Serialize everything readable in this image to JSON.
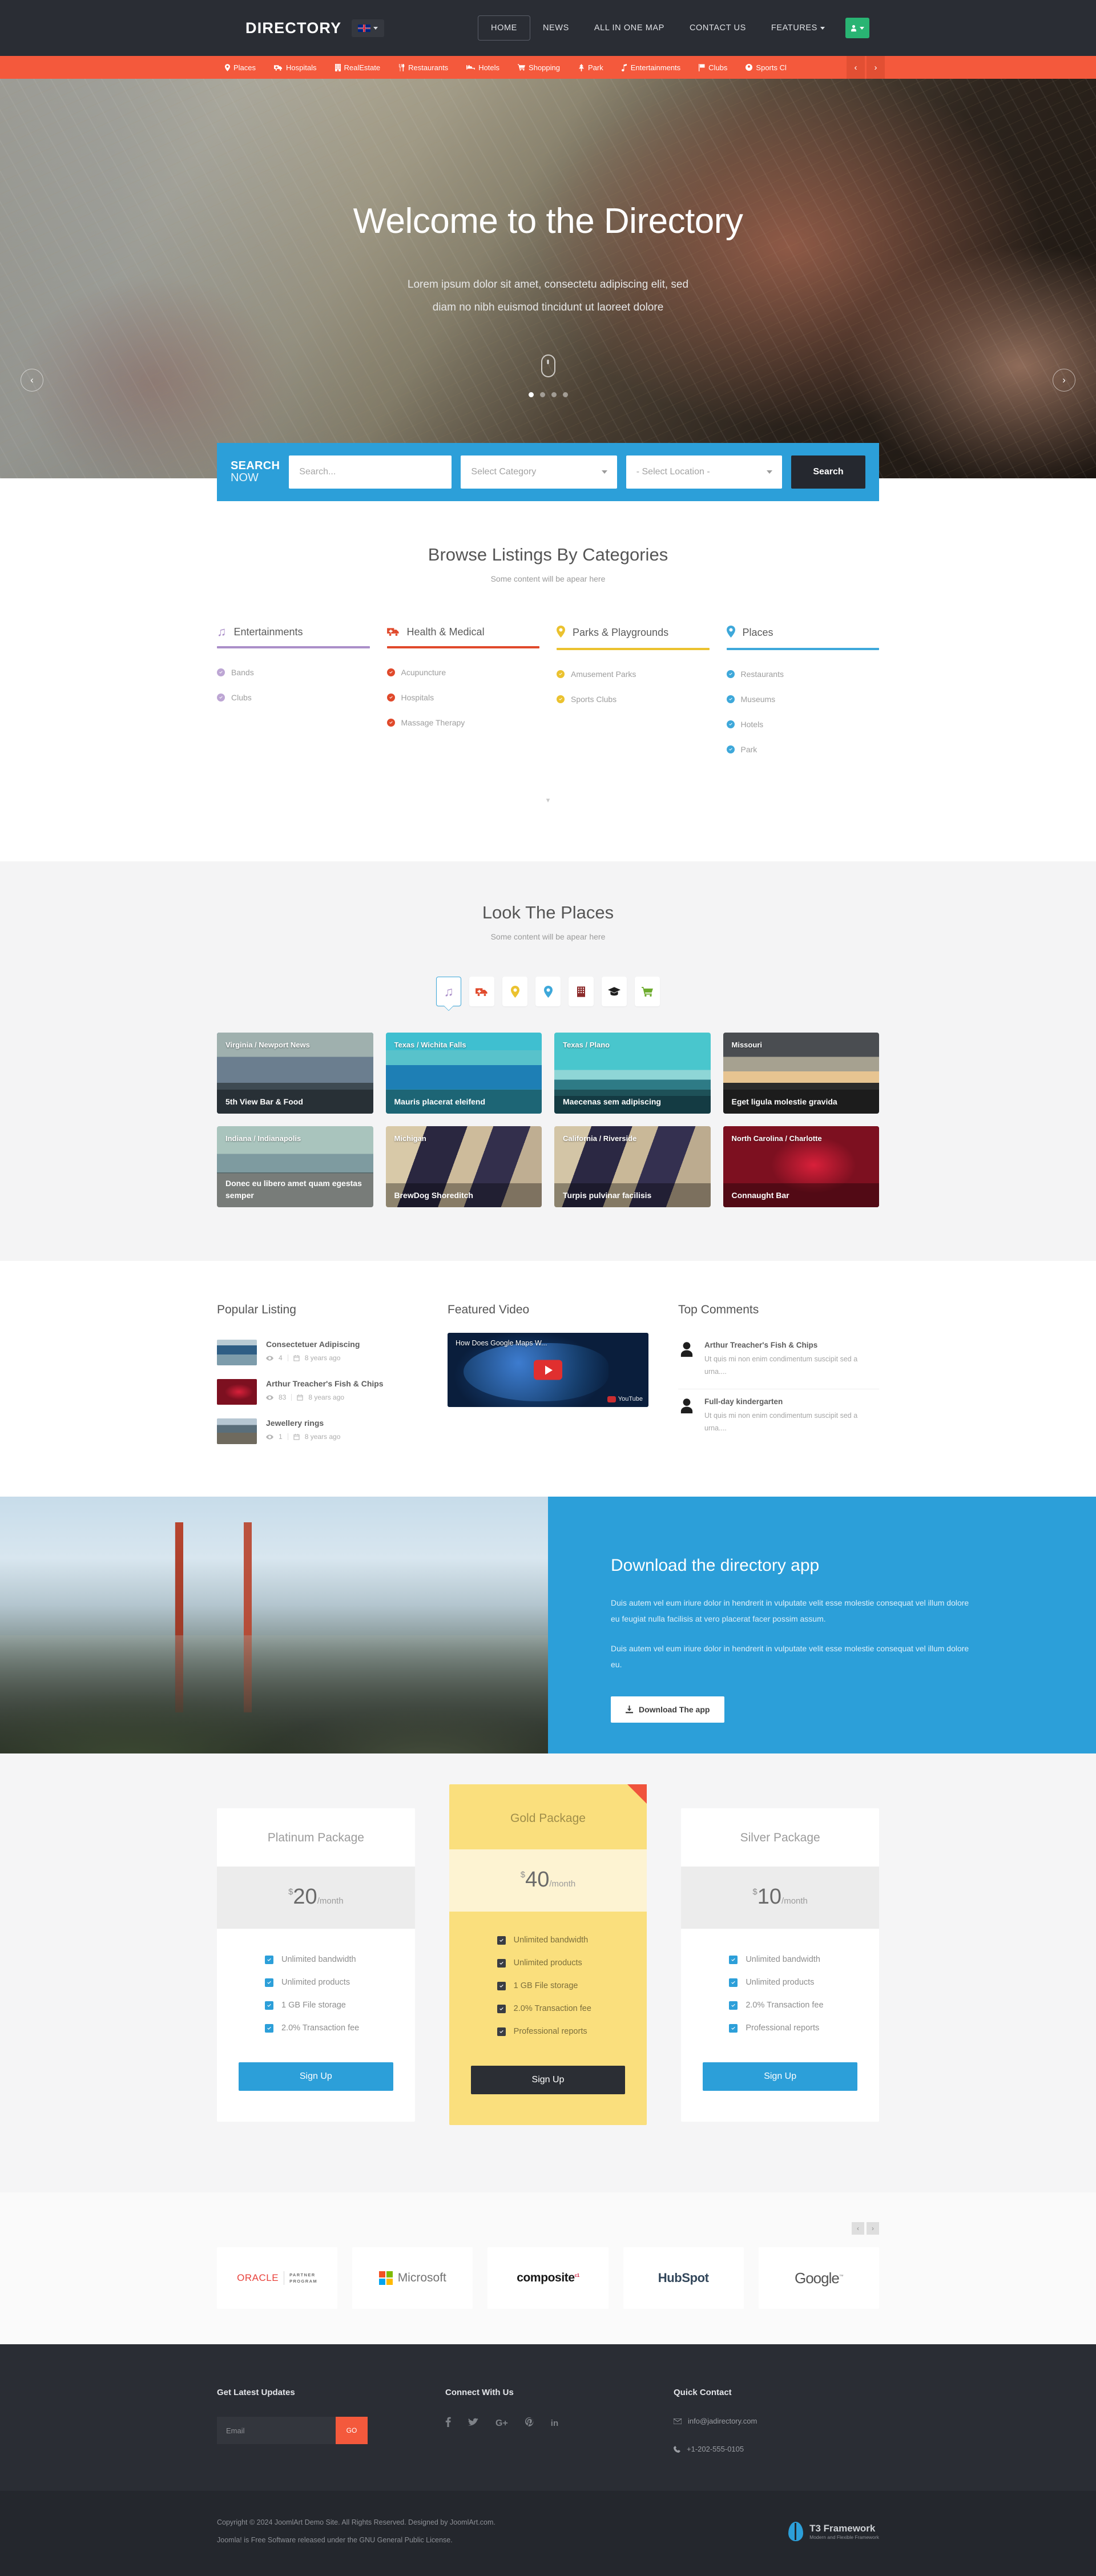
{
  "header": {
    "brand": "DIRECTORY",
    "lang_icon": "uk-flag-icon",
    "menu": [
      {
        "label": "HOME",
        "active": true,
        "caret": false
      },
      {
        "label": "NEWS",
        "active": false,
        "caret": false
      },
      {
        "label": "ALL IN ONE MAP",
        "active": false,
        "caret": false
      },
      {
        "label": "CONTACT US",
        "active": false,
        "caret": false
      },
      {
        "label": "FEATURES",
        "active": false,
        "caret": true
      }
    ],
    "user_icon": "user-icon",
    "user_accent": "#29b473"
  },
  "category_bar": {
    "accent": "#f4593c",
    "items": [
      {
        "label": "Places",
        "icon": "map-marker-icon"
      },
      {
        "label": "Hospitals",
        "icon": "ambulance-icon"
      },
      {
        "label": "RealEstate",
        "icon": "building-icon"
      },
      {
        "label": "Restaurants",
        "icon": "cutlery-icon"
      },
      {
        "label": "Hotels",
        "icon": "bed-icon"
      },
      {
        "label": "Shopping",
        "icon": "shopping-cart-icon"
      },
      {
        "label": "Park",
        "icon": "tree-icon"
      },
      {
        "label": "Entertainments",
        "icon": "music-icon"
      },
      {
        "label": "Clubs",
        "icon": "flag-icon"
      },
      {
        "label": "Sports Cl",
        "icon": "soccer-ball-icon"
      }
    ],
    "prev": "‹",
    "next": "›"
  },
  "hero": {
    "title": "Welcome to the Directory",
    "subtitle_line1": "Lorem ipsum dolor sit amet, consectetu adipiscing elit, sed",
    "subtitle_line2": "diam no nibh euismod tincidunt ut laoreet dolore",
    "prev": "‹",
    "next": "›",
    "dots": 4,
    "active_dot": 0,
    "scroll_icon": "mouse-scroll-icon"
  },
  "search": {
    "label_top": "SEARCH",
    "label_bottom": "NOW",
    "placeholder": "Search...",
    "category_value": "Select Category",
    "location_value": "- Select Location -",
    "button": "Search",
    "accent": "#2c9fd9"
  },
  "browse": {
    "title": "Browse Listings By Categories",
    "subtitle": "Some content will be apear here",
    "more_icon": "chevron-down-icon",
    "columns": [
      {
        "name": "Entertainments",
        "icon": "music-note-icon",
        "color": "#ab8fc9",
        "items": [
          "Bands",
          "Clubs"
        ]
      },
      {
        "name": "Health & Medical",
        "icon": "ambulance-icon",
        "color": "#e0492b",
        "items": [
          "Acupuncture",
          "Hospitals",
          "Massage Therapy"
        ]
      },
      {
        "name": "Parks & Playgrounds",
        "icon": "map-marker-icon",
        "color": "#ebc22f",
        "items": [
          "Amusement Parks",
          "Sports Clubs"
        ]
      },
      {
        "name": "Places",
        "icon": "map-marker-icon",
        "color": "#3ea8da",
        "items": [
          "Restaurants",
          "Museums",
          "Hotels",
          "Park"
        ]
      }
    ]
  },
  "look_places": {
    "title": "Look The Places",
    "subtitle": "Some content will be apear here",
    "tabs": [
      {
        "icon": "music-note-icon",
        "color": "#ab8fc9",
        "active": true
      },
      {
        "icon": "ambulance-icon",
        "color": "#e0492b",
        "active": false
      },
      {
        "icon": "map-marker-icon",
        "color": "#ebc22f",
        "active": false
      },
      {
        "icon": "map-marker-icon",
        "color": "#3ea8da",
        "active": false
      },
      {
        "icon": "building-icon",
        "color": "#8c2b2b",
        "active": false
      },
      {
        "icon": "graduation-cap-icon",
        "color": "#1e1e1e",
        "active": false
      },
      {
        "icon": "shopping-cart-icon",
        "color": "#6cab2d",
        "active": false
      }
    ],
    "cards": [
      {
        "location": "Virginia / Newport News",
        "name": "5th View Bar & Food"
      },
      {
        "location": "Texas / Wichita Falls",
        "name": "Mauris placerat eleifend"
      },
      {
        "location": "Texas / Plano",
        "name": "Maecenas sem adipiscing"
      },
      {
        "location": "Missouri",
        "name": "Eget ligula molestie gravida"
      },
      {
        "location": "Indiana / Indianapolis",
        "name": "Donec eu libero amet quam egestas semper"
      },
      {
        "location": "Michigan",
        "name": "BrewDog Shoreditch"
      },
      {
        "location": "California / Riverside",
        "name": "Turpis pulvinar facilisis"
      },
      {
        "location": "North Carolina / Charlotte",
        "name": "Connaught Bar"
      }
    ]
  },
  "popular": {
    "title": "Popular Listing",
    "items": [
      {
        "name": "Consectetuer Adipiscing",
        "views": "4",
        "date": "8 years ago"
      },
      {
        "name": "Arthur Treacher's Fish & Chips",
        "views": "83",
        "date": "8 years ago"
      },
      {
        "name": "Jewellery rings",
        "views": "1",
        "date": "8 years ago"
      }
    ],
    "view_icon": "eye-icon",
    "date_icon": "calendar-icon"
  },
  "featured_video": {
    "title": "Featured Video",
    "video_title": "How Does Google Maps W...",
    "play_icon": "play-button-icon",
    "watermark": "YouTube"
  },
  "comments": {
    "title": "Top Comments",
    "items": [
      {
        "name": "Arthur Treacher's Fish & Chips",
        "text": "Ut quis mi non enim condimentum suscipit sed a urna...."
      },
      {
        "name": "Full-day kindergarten",
        "text": "Ut quis mi non enim condimentum suscipit sed a urna...."
      }
    ],
    "avatar_icon": "user-avatar-icon"
  },
  "download": {
    "title": "Download the directory app",
    "p1": "Duis autem vel eum iriure dolor in hendrerit in vulputate velit esse molestie consequat vel illum dolore eu feugiat nulla facilisis at vero placerat facer possim assum.",
    "p2": "Duis autem vel eum iriure dolor in hendrerit in vulputate velit esse molestie consequat vel illum dolore eu.",
    "button": "Download The app",
    "button_icon": "download-icon",
    "accent": "#2c9fd9"
  },
  "pricing": {
    "packages": [
      {
        "name": "Platinum Package",
        "currency": "$",
        "amount": "20",
        "period": "/month",
        "featured": false,
        "button": "Sign Up",
        "features": [
          "Unlimited bandwidth",
          "Unlimited products",
          "1 GB File storage",
          "2.0% Transaction fee"
        ]
      },
      {
        "name": "Gold Package",
        "currency": "$",
        "amount": "40",
        "period": "/month",
        "featured": true,
        "button": "Sign Up",
        "features": [
          "Unlimited bandwidth",
          "Unlimited products",
          "1 GB File storage",
          "2.0% Transaction fee",
          "Professional reports"
        ]
      },
      {
        "name": "Silver Package",
        "currency": "$",
        "amount": "10",
        "period": "/month",
        "featured": false,
        "button": "Sign Up",
        "features": [
          "Unlimited bandwidth",
          "Unlimited products",
          "2.0% Transaction fee",
          "Professional reports"
        ]
      }
    ]
  },
  "logos": {
    "prev": "‹",
    "next": "›",
    "items": [
      {
        "name": "ORACLE",
        "sub1": "PARTNER",
        "sub2": "PROGRAM",
        "kind": "oracle"
      },
      {
        "name": "Microsoft",
        "kind": "microsoft"
      },
      {
        "name": "composite",
        "kind": "composite",
        "sup": "c1"
      },
      {
        "name": "HubSpot",
        "kind": "hubspot"
      },
      {
        "name": "Google",
        "kind": "google",
        "sup": "™"
      }
    ]
  },
  "footer": {
    "newsletter": {
      "heading": "Get Latest Updates",
      "placeholder": "Email",
      "button": "GO"
    },
    "connect": {
      "heading": "Connect With Us",
      "socials": [
        {
          "icon": "facebook-icon",
          "glyph": "f"
        },
        {
          "icon": "twitter-icon",
          "glyph": "🐦"
        },
        {
          "icon": "google-plus-icon",
          "glyph": "G+"
        },
        {
          "icon": "pinterest-icon",
          "glyph": "Ⓟ"
        },
        {
          "icon": "linkedin-icon",
          "glyph": "in"
        }
      ]
    },
    "contact": {
      "heading": "Quick Contact",
      "email": "info@jadirectory.com",
      "phone": "+1-202-555-0105",
      "email_icon": "envelope-icon",
      "phone_icon": "phone-icon"
    },
    "copyright_line1": "Copyright © 2024 JoomlArt Demo Site. All Rights Reserved. Designed by JoomlArt.com.",
    "copyright_line2": "Joomla! is Free Software released under the GNU General Public License.",
    "t3_name": "T3 Framework",
    "t3_tag": "Modern and Flexible Framework"
  }
}
